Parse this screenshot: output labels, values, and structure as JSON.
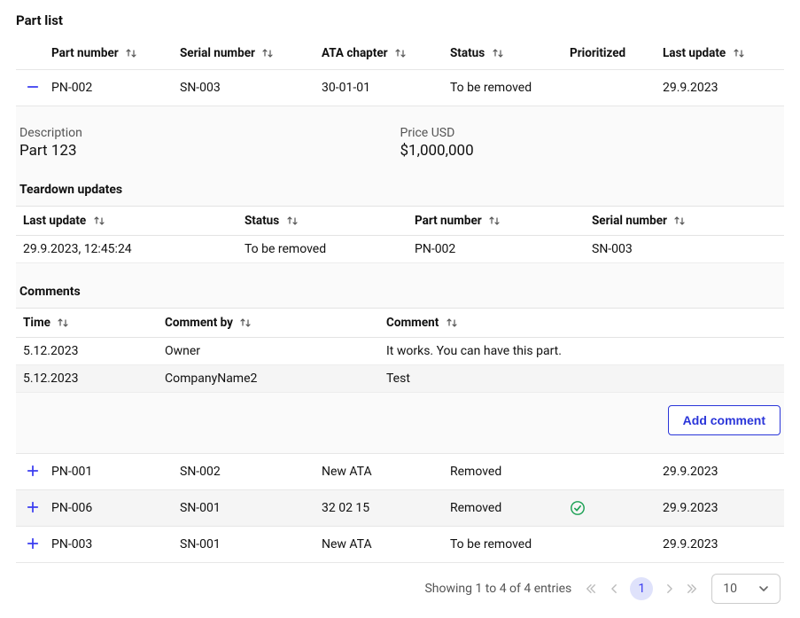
{
  "title": "Part list",
  "columns": {
    "part_number": "Part number",
    "serial_number": "Serial number",
    "ata_chapter": "ATA chapter",
    "status": "Status",
    "prioritized": "Prioritized",
    "last_update": "Last update"
  },
  "rows": [
    {
      "part_number": "PN-002",
      "serial_number": "SN-003",
      "ata_chapter": "30-01-01",
      "status": "To be removed",
      "prioritized": "",
      "last_update": "29.9.2023",
      "expanded": true
    },
    {
      "part_number": "PN-001",
      "serial_number": "SN-002",
      "ata_chapter": "New ATA",
      "status": "Removed",
      "prioritized": "",
      "last_update": "29.9.2023",
      "expanded": false
    },
    {
      "part_number": "PN-006",
      "serial_number": "SN-001",
      "ata_chapter": "32 02 15",
      "status": "Removed",
      "prioritized": "check",
      "last_update": "29.9.2023",
      "expanded": false
    },
    {
      "part_number": "PN-003",
      "serial_number": "SN-001",
      "ata_chapter": "New ATA",
      "status": "To be removed",
      "prioritized": "",
      "last_update": "29.9.2023",
      "expanded": false
    }
  ],
  "expanded": {
    "description_label": "Description",
    "description_value": "Part 123",
    "price_label": "Price USD",
    "price_value": "$1,000,000",
    "teardown_heading": "Teardown updates",
    "teardown_columns": {
      "last_update": "Last update",
      "status": "Status",
      "part_number": "Part number",
      "serial_number": "Serial number"
    },
    "teardown_rows": [
      {
        "last_update": "29.9.2023, 12:45:24",
        "status": "To be removed",
        "part_number": "PN-002",
        "serial_number": "SN-003"
      }
    ],
    "comments_heading": "Comments",
    "comments_columns": {
      "time": "Time",
      "comment_by": "Comment by",
      "comment": "Comment"
    },
    "comments_rows": [
      {
        "time": "5.12.2023",
        "comment_by": "Owner",
        "comment": "It works. You can have this part."
      },
      {
        "time": "5.12.2023",
        "comment_by": "CompanyName2",
        "comment": "Test"
      }
    ],
    "add_button": "Add comment"
  },
  "footer": {
    "showing": "Showing 1 to 4 of 4 entries",
    "current_page": "1",
    "page_size": "10"
  }
}
